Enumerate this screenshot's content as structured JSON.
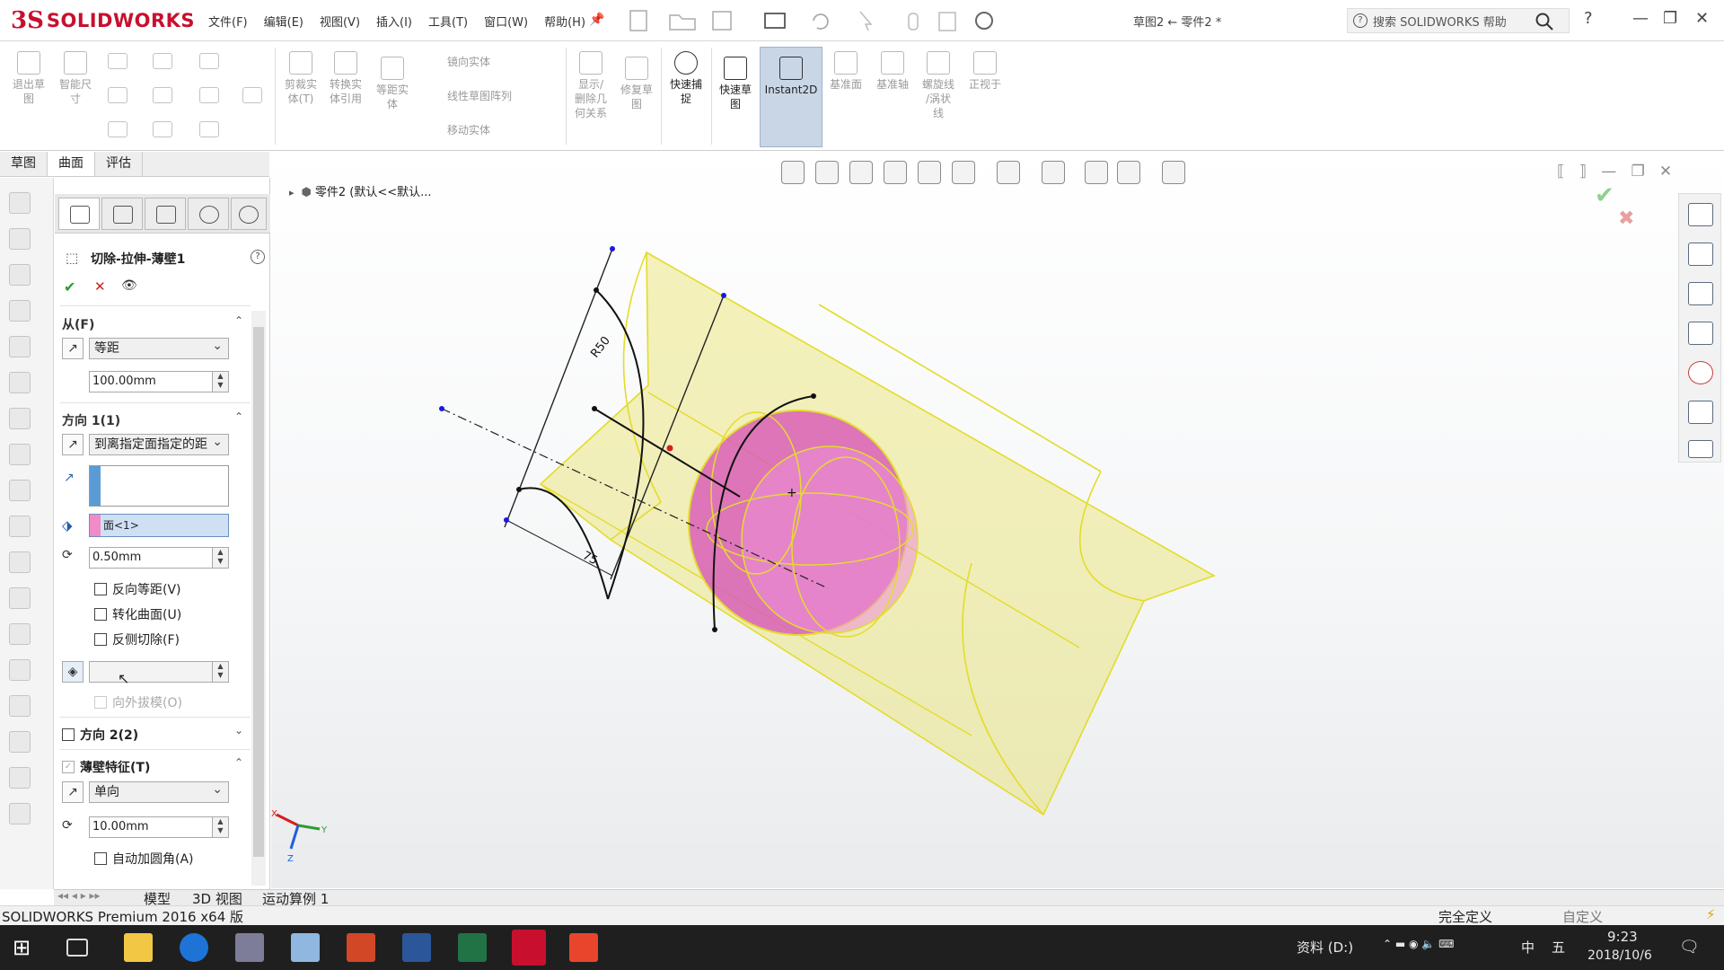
{
  "app": {
    "logo_ds": "3S",
    "logo_name": "SOLIDWORKS",
    "document_title": "草图2 ← 零件2 *",
    "search_placeholder": "搜索 SOLIDWORKS 帮助"
  },
  "menu": [
    "文件(F)",
    "编辑(E)",
    "视图(V)",
    "插入(I)",
    "工具(T)",
    "窗口(W)",
    "帮助(H)"
  ],
  "ribbon": {
    "exit_sketch": "退出草\n图",
    "smart_dim": "智能尺\n寸",
    "trim": "剪裁实\n体(T)",
    "convert": "转换实\n体引用",
    "offset": "等距实\n体",
    "mirror": "镜向实体",
    "linear_pattern": "线性草图阵列",
    "move": "移动实体",
    "display_relations": "显示/\n删除几\n何关系",
    "repair": "修复草\n图",
    "quick_snap": "快速捕\n捉",
    "rapid_sketch": "快速草\n图",
    "instant2d": "Instant2D",
    "ref_plane": "基准面",
    "ref_axis": "基准轴",
    "helix": "螺旋线\n/涡状\n线",
    "normal_to": "正视于"
  },
  "cm_tabs": [
    "草图",
    "曲面",
    "评估"
  ],
  "pm": {
    "title": "切除-拉伸-薄壁1",
    "from_label": "从(F)",
    "from_type": "等距",
    "from_value": "100.00mm",
    "dir1_label": "方向 1(1)",
    "dir1_type": "到离指定面指定的距",
    "face_ref": "面<1>",
    "offset_value": "0.50mm",
    "reverse_offset": "反向等距(V)",
    "translate_surface": "转化曲面(U)",
    "flip_side": "反侧切除(F)",
    "draft_outward": "向外拔模(O)",
    "dir2_label": "方向 2(2)",
    "thin_label": "薄壁特征(T)",
    "thin_type": "单向",
    "thin_value": "10.00mm",
    "auto_fillet": "自动加圆角(A)"
  },
  "viewport": {
    "tree_text": "零件2  (默认<<默认...",
    "dim_r": "R50",
    "dim_len": "75",
    "axis_x": "X",
    "axis_y": "Y",
    "axis_z": "Z"
  },
  "doc_tabs": [
    "模型",
    "3D 视图",
    "运动算例 1"
  ],
  "status": {
    "product": "SOLIDWORKS Premium 2016 x64 版",
    "state": "完全定义",
    "units": "自定义"
  },
  "taskbar": {
    "location": "资料 (D:)",
    "ime1": "中",
    "ime2": "五",
    "time": "9:23",
    "date": "2018/10/6"
  },
  "colors": {
    "brand": "#c8102e",
    "model_yellow": "#e9e36a",
    "model_pink": "#d85ab8"
  }
}
